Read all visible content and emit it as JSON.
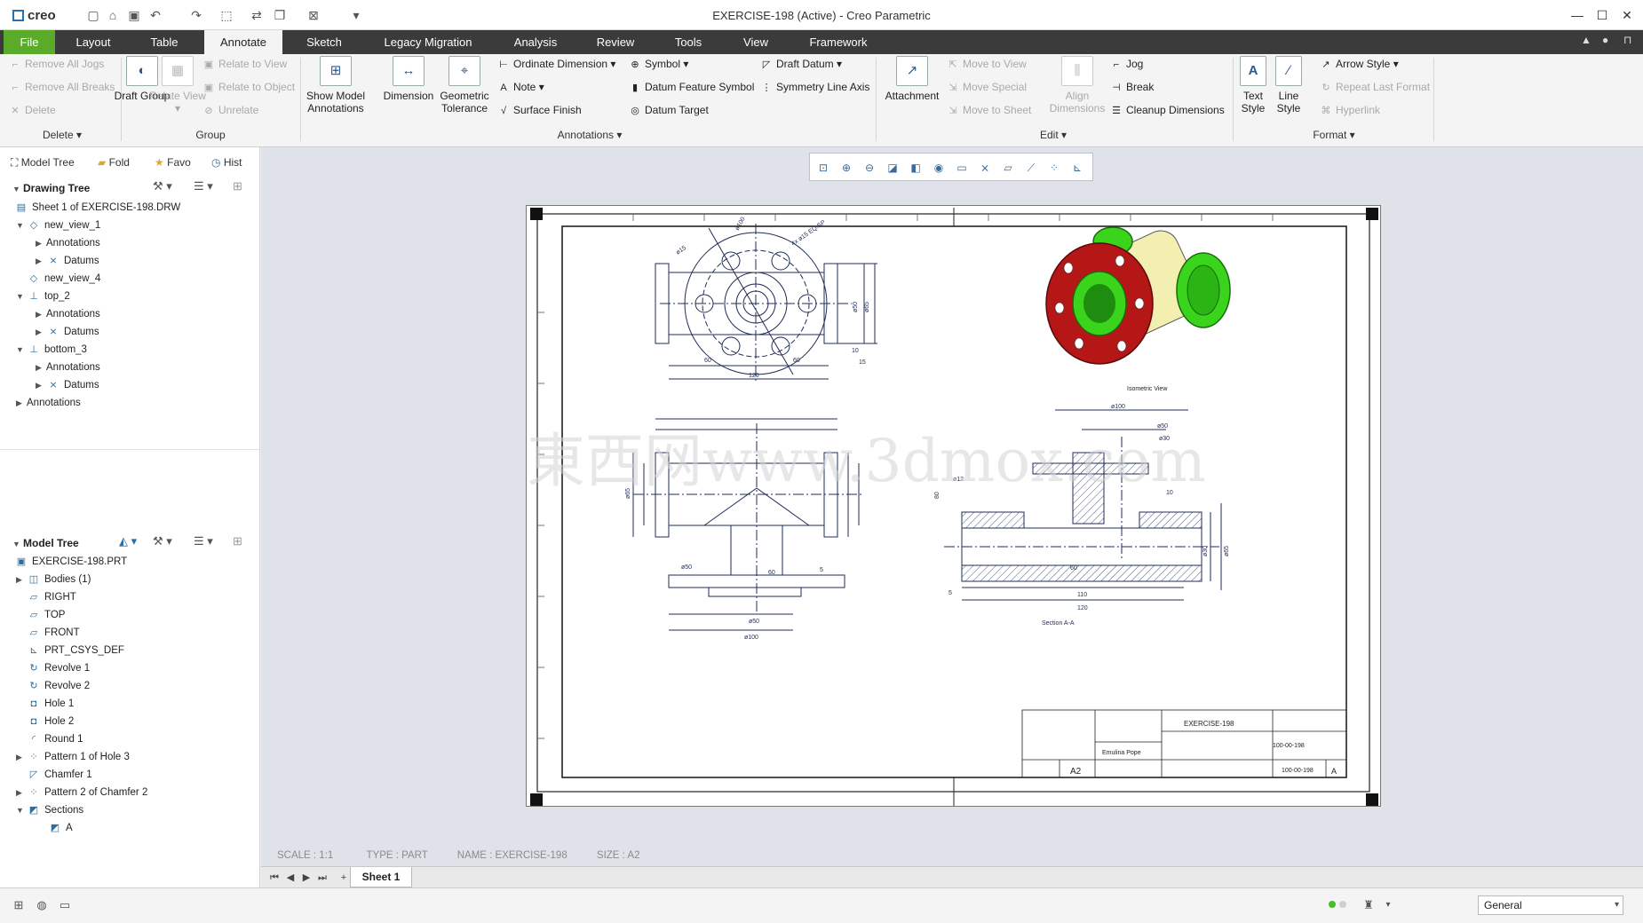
{
  "app": {
    "logo": "creo",
    "window_title": "EXERCISE-198 (Active) - Creo Parametric"
  },
  "tabs": [
    "File",
    "Layout",
    "Table",
    "Annotate",
    "Sketch",
    "Legacy Migration",
    "Analysis",
    "Review",
    "Tools",
    "View",
    "Framework"
  ],
  "active_tab": "Annotate",
  "ribbon": {
    "delete_group": {
      "items": [
        "Remove All Jogs",
        "Remove All Breaks",
        "Delete"
      ],
      "label": "Delete"
    },
    "group_group": {
      "draft_group": "Draft Group",
      "relate_view": "Relate View",
      "items": [
        "Relate to View",
        "Relate to Object",
        "Unrelate"
      ],
      "label": "Group"
    },
    "annotations_group": {
      "show_model_annotations": "Show Model Annotations",
      "dimension": "Dimension",
      "geometric_tolerance": "Geometric Tolerance",
      "col1": [
        "Ordinate Dimension",
        "Note",
        "Surface Finish"
      ],
      "col2": [
        "Symbol",
        "Datum Feature Symbol",
        "Datum Target"
      ],
      "col3": [
        "Draft Datum",
        "Symmetry Line Axis"
      ],
      "label": "Annotations"
    },
    "edit_group": {
      "attachment": "Attachment",
      "col1": [
        "Move to View",
        "Move Special",
        "Move to Sheet"
      ],
      "align_dimensions": "Align Dimensions",
      "col2": [
        "Jog",
        "Break",
        "Cleanup Dimensions"
      ],
      "label": "Edit"
    },
    "format_group": {
      "text_style": "Text Style",
      "line_style": "Line Style",
      "items": [
        "Arrow Style",
        "Repeat Last Format",
        "Hyperlink"
      ],
      "label": "Format"
    }
  },
  "left_panel": {
    "nav_tabs": [
      "Model Tree",
      "Fold",
      "Favo",
      "Hist"
    ],
    "drawing_tree": {
      "title": "Drawing Tree",
      "items": [
        {
          "label": "Sheet 1 of EXERCISE-198.DRW",
          "icon": "sheet-icon"
        },
        {
          "label": "new_view_1",
          "icon": "view-icon"
        },
        {
          "label": "Annotations",
          "icon": ""
        },
        {
          "label": "Datums",
          "icon": "datum-icon"
        },
        {
          "label": "new_view_4",
          "icon": "view-icon"
        },
        {
          "label": "top_2",
          "icon": "view-icon"
        },
        {
          "label": "Annotations",
          "icon": ""
        },
        {
          "label": "Datums",
          "icon": "datum-icon"
        },
        {
          "label": "bottom_3",
          "icon": "view-icon"
        },
        {
          "label": "Annotations",
          "icon": ""
        },
        {
          "label": "Datums",
          "icon": "datum-icon"
        },
        {
          "label": "Annotations",
          "icon": ""
        }
      ]
    },
    "model_tree": {
      "title": "Model Tree",
      "items": [
        {
          "label": "EXERCISE-198.PRT",
          "icon": "part-icon"
        },
        {
          "label": "Bodies (1)",
          "icon": "body-icon"
        },
        {
          "label": "RIGHT",
          "icon": "plane-icon"
        },
        {
          "label": "TOP",
          "icon": "plane-icon"
        },
        {
          "label": "FRONT",
          "icon": "plane-icon"
        },
        {
          "label": "PRT_CSYS_DEF",
          "icon": "csys-icon"
        },
        {
          "label": "Revolve 1",
          "icon": "revolve-icon"
        },
        {
          "label": "Revolve 2",
          "icon": "revolve-icon"
        },
        {
          "label": "Hole 1",
          "icon": "hole-icon"
        },
        {
          "label": "Hole 2",
          "icon": "hole-icon"
        },
        {
          "label": "Round 1",
          "icon": "round-icon"
        },
        {
          "label": "Pattern 1 of Hole 3",
          "icon": "pattern-icon"
        },
        {
          "label": "Chamfer 1",
          "icon": "chamfer-icon"
        },
        {
          "label": "Pattern 2 of Chamfer 2",
          "icon": "pattern-icon"
        },
        {
          "label": "Sections",
          "icon": "section-icon"
        },
        {
          "label": "A",
          "icon": "section-icon"
        }
      ]
    }
  },
  "drawing": {
    "dims": {
      "d_phi100_top": "ø100",
      "d_phi15": "ø15",
      "d_4x_phi15": "4x ø15 EQ.SP",
      "d_phi50_r": "ø50",
      "d_phi65_r": "ø65",
      "d_10": "10",
      "d_15": "15",
      "d_60a": "60",
      "d_60b": "60",
      "d_120": "120",
      "d_phi65_l": "ø65",
      "d_phi50_b": "ø50",
      "d_60c": "60",
      "d_5": "5",
      "d_phi50_c": "ø50",
      "d_phi100_b": "ø100",
      "s_phi100": "ø100",
      "s_phi50": "ø50",
      "s_phi30": "ø30",
      "s_phi12": "ø12",
      "s_10": "10",
      "s_80": "80",
      "s_110": "110",
      "s_120": "120",
      "s_60": "60",
      "s_5": "5",
      "s_phi30b": "ø30",
      "s_phi65": "ø65"
    },
    "iso_label": "Isometric View",
    "section_label": "Section A-A",
    "watermark": "東西网www.3dmox.com",
    "title_block": {
      "title": "EXERCISE-198",
      "number_1": "100-00-198",
      "number_2": "100-00-198",
      "size": "A2",
      "rev": "A",
      "company": "Emulina Pope"
    }
  },
  "status_info": {
    "scale": "SCALE : 1:1",
    "type": "TYPE : PART",
    "name": "NAME : EXERCISE-198",
    "size": "SIZE : A2"
  },
  "sheet_tab": "Sheet 1",
  "filter": "General",
  "colors": {
    "file_tab": "#5bab2a",
    "tab_bar": "#3b3b3b",
    "graphics_bg": "#dfe3e9",
    "flange_red": "#b51616",
    "pipe_green": "#3ad41c",
    "body_cream": "#f3efb0"
  }
}
